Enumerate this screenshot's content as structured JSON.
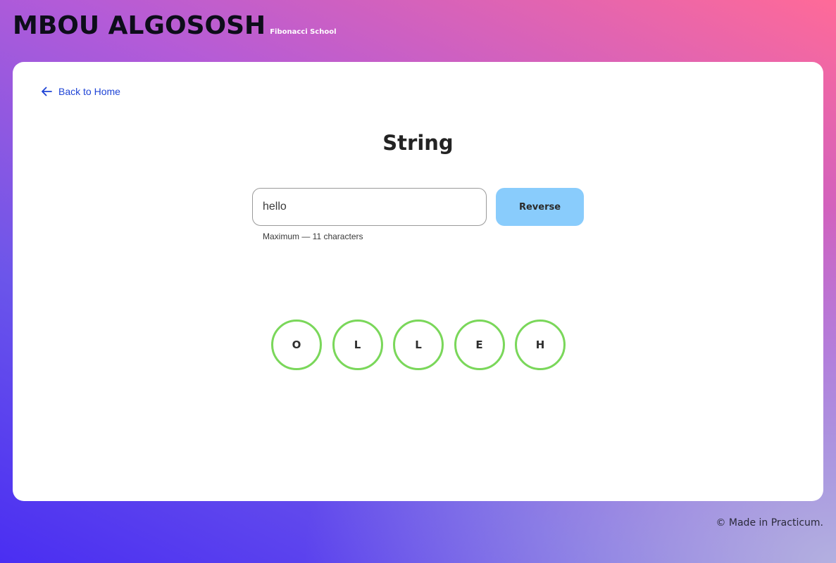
{
  "header": {
    "brand": "MBOU ALGOSOSH",
    "subtitle": "Fibonacci School"
  },
  "nav": {
    "back_label": "Back to Home",
    "back_icon": "arrow-left-icon"
  },
  "main": {
    "title": "String",
    "input": {
      "value": "hello",
      "placeholder": ""
    },
    "hint": "Maximum — 11 characters",
    "reverse_label": "Reverse",
    "result_letters": [
      "O",
      "L",
      "L",
      "E",
      "H"
    ]
  },
  "colors": {
    "accent_link": "#1f44d6",
    "button": "#89ccfc",
    "circle_modified": "#7ad75a"
  },
  "footer": {
    "text": "© Made in Practicum."
  }
}
